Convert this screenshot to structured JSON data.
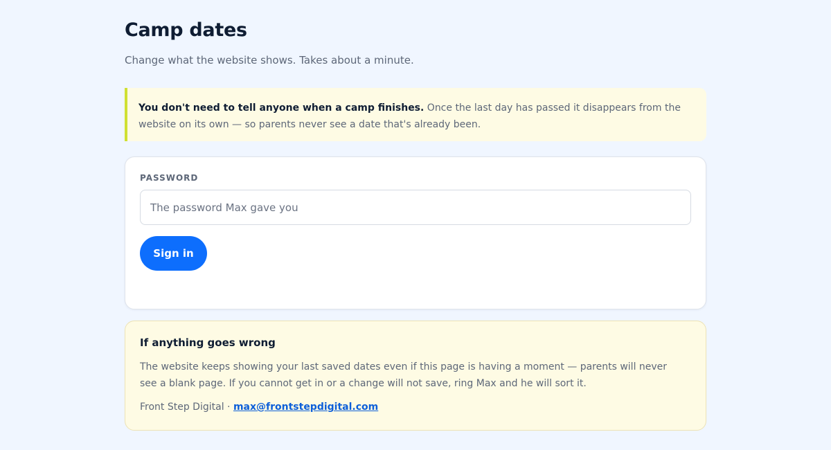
{
  "page": {
    "title": "Camp dates",
    "subtitle": "Change what the website shows. Takes about a minute."
  },
  "notice": {
    "strong": "You don't need to tell anyone when a camp finishes.",
    "body": " Once the last day has passed it disappears from the website on its own — so parents never see a date that's already been."
  },
  "login": {
    "password_label": "PASSWORD",
    "password_placeholder": "The password Max gave you",
    "password_value": "",
    "signin_label": "Sign in"
  },
  "help": {
    "title": "If anything goes wrong",
    "body": "The website keeps showing your last saved dates even if this page is having a moment — parents will never see a blank page. If you cannot get in or a change will not save, ring Max and he will sort it.",
    "company": "Front Step Digital · ",
    "email": "max@frontstepdigital.com"
  },
  "colors": {
    "background": "#f0f6ff",
    "accent": "#0d6efd",
    "notice_bg": "#fefbe4",
    "notice_border": "#cfe033"
  }
}
